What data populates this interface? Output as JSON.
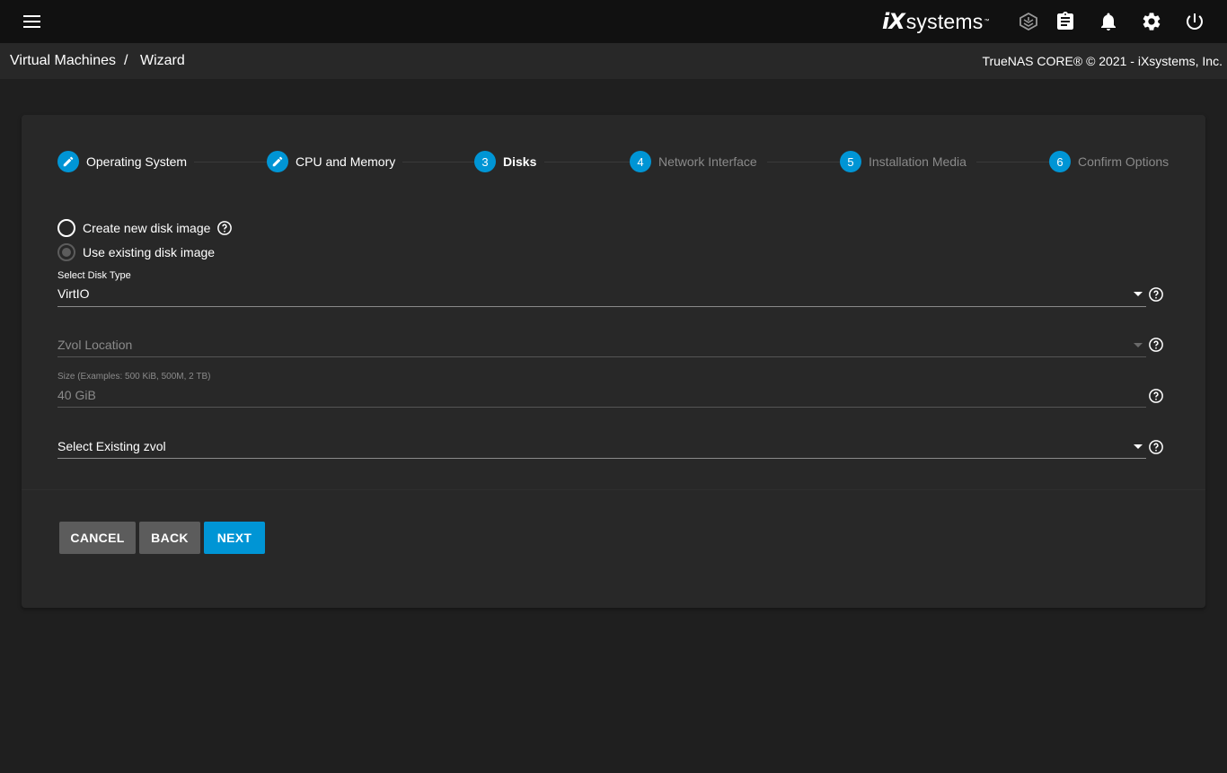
{
  "topbar": {
    "brand_ix": "iX",
    "brand_systems": "systems",
    "brand_tm": "™",
    "icons": [
      "menu-icon",
      "truecommand-icon",
      "clipboard-icon",
      "bell-icon",
      "gear-icon",
      "power-icon"
    ]
  },
  "breadcrumb": {
    "items": [
      "Virtual Machines",
      "Wizard"
    ],
    "separator": "/"
  },
  "copyright": "TrueNAS CORE® © 2021 - iXsystems, Inc.",
  "wizard": {
    "steps": [
      {
        "number": "1",
        "label": "Operating System",
        "state": "done"
      },
      {
        "number": "2",
        "label": "CPU and Memory",
        "state": "done"
      },
      {
        "number": "3",
        "label": "Disks",
        "state": "active"
      },
      {
        "number": "4",
        "label": "Network Interface",
        "state": "pending"
      },
      {
        "number": "5",
        "label": "Installation Media",
        "state": "pending"
      },
      {
        "number": "6",
        "label": "Confirm Options",
        "state": "pending"
      }
    ],
    "disk_options": [
      {
        "label": "Create new disk image",
        "selected": false
      },
      {
        "label": "Use existing disk image",
        "selected": true
      }
    ],
    "fields": {
      "disk_type": {
        "label": "Select Disk Type",
        "value": "VirtIO"
      },
      "zvol_location": {
        "placeholder": "Zvol Location"
      },
      "size": {
        "label": "Size (Examples: 500 KiB, 500M, 2 TB)",
        "value": "40 GiB"
      },
      "existing_zvol": {
        "placeholder": "Select Existing zvol"
      }
    },
    "buttons": {
      "cancel": "CANCEL",
      "back": "BACK",
      "next": "NEXT"
    }
  },
  "colors": {
    "accent": "#0095d5",
    "topbar": "#111111",
    "breadbar": "#282828",
    "background": "#1f1f1f",
    "card": "#282828",
    "button_grey": "#5c5c5c"
  }
}
